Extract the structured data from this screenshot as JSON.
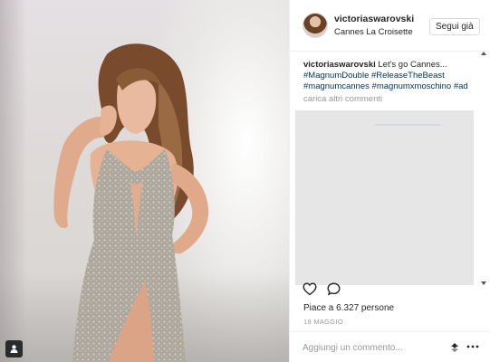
{
  "post": {
    "username": "victoriaswarovski",
    "location": "Cannes La Croisette",
    "follow_label": "Segui già"
  },
  "caption": {
    "username": "victoriaswarovski",
    "text": "Let's go Cannes...",
    "hashtags": [
      "#MagnumDouble",
      "#ReleaseTheBeast",
      "#magnumcannes",
      "#magnumxmoschino",
      "#ad"
    ]
  },
  "comments": {
    "load_more_label": "carica altri commenti"
  },
  "stats": {
    "likes_text": "Piace a 6.327 persone",
    "date_text": "18 MAGGIO"
  },
  "comment_input": {
    "placeholder": "Aggiungi un commento..."
  },
  "icons": {
    "like": "heart-icon",
    "comment": "speech-bubble-icon",
    "emoji": "emoji-icon",
    "more": "more-options-icon",
    "user_tag": "person-tag-icon"
  },
  "colors": {
    "hashtag": "#003569",
    "text": "#262626",
    "muted": "#999999",
    "border": "#efefef"
  }
}
